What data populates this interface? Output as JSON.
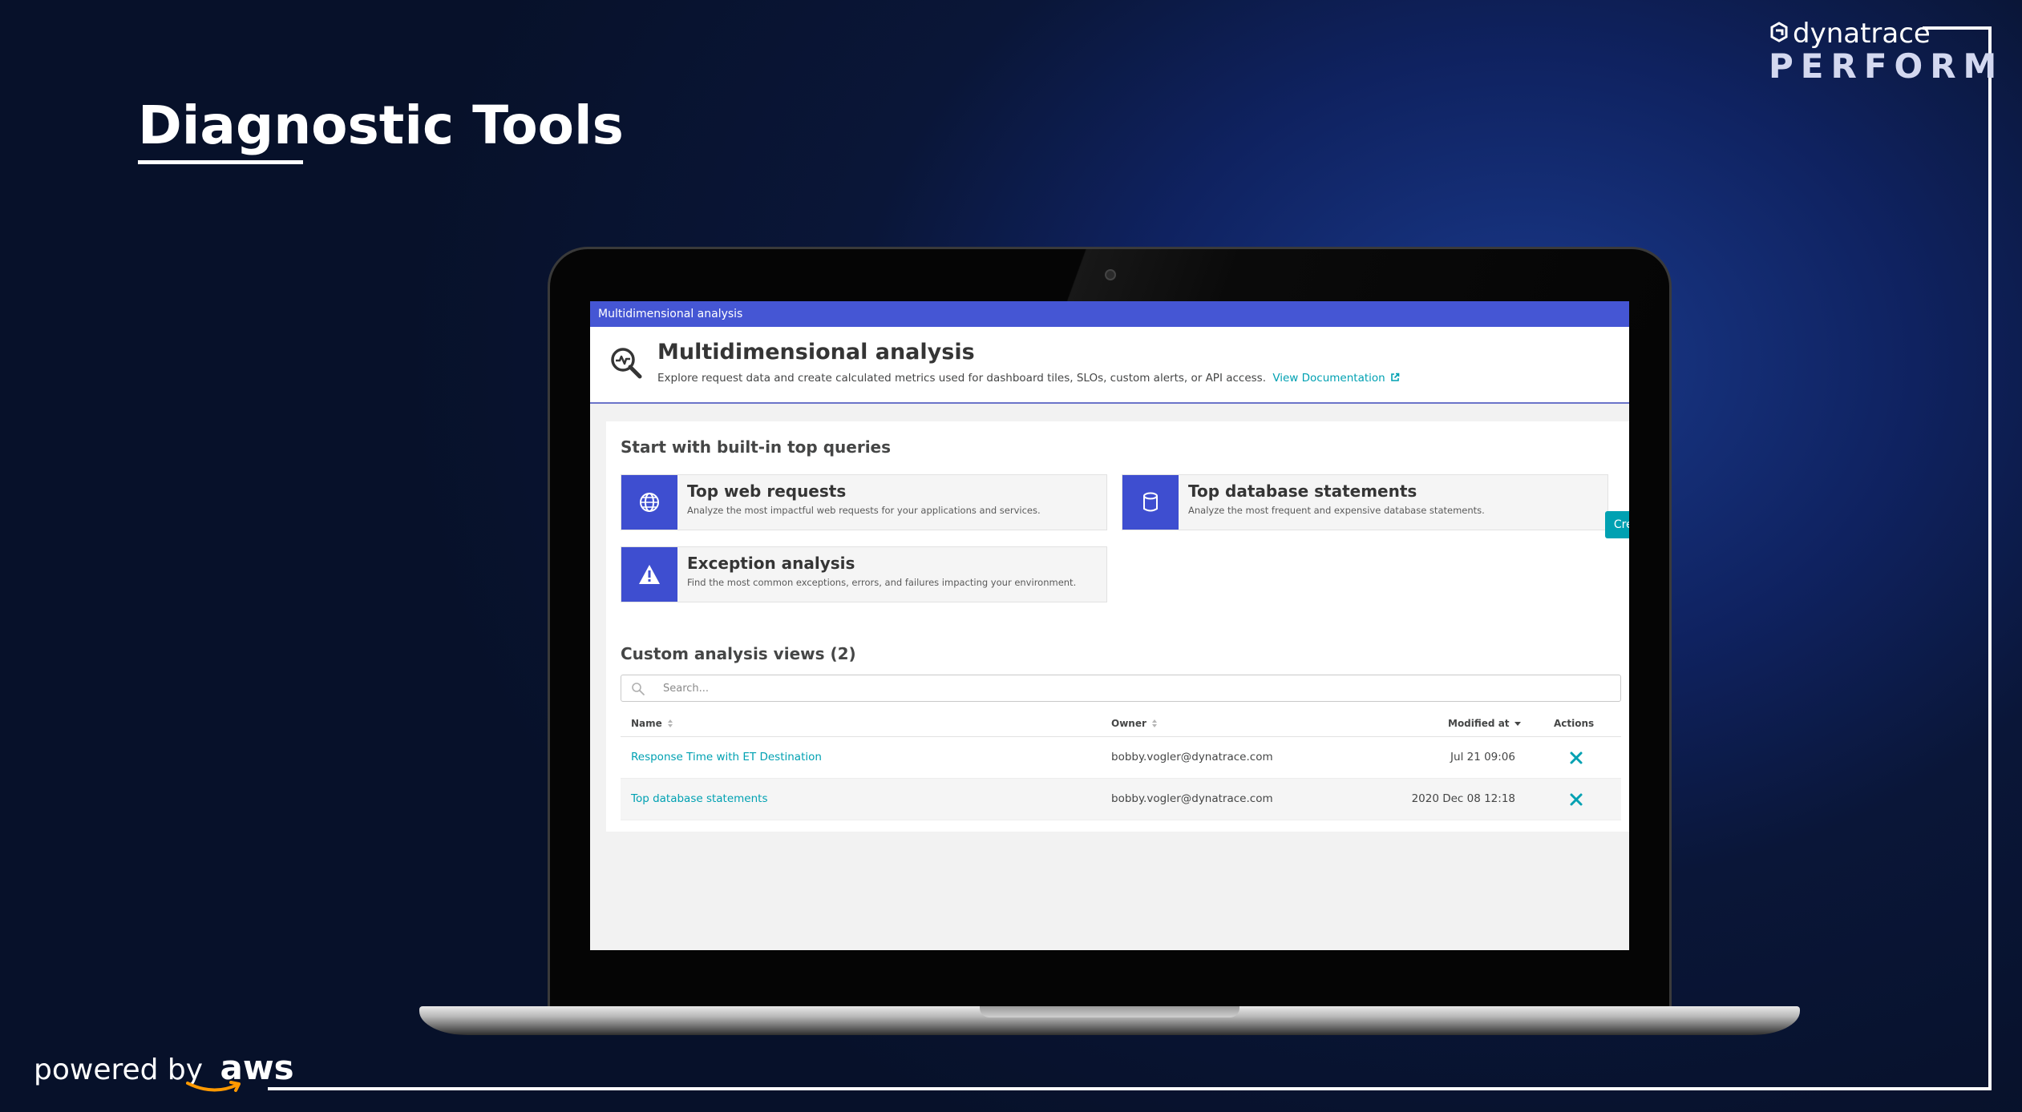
{
  "slide": {
    "title": "Diagnostic Tools",
    "brand_word": "dynatrace",
    "brand_event": "PERFORM",
    "powered_by": "powered by",
    "aws": "aws"
  },
  "app": {
    "bar_title": "Multidimensional analysis",
    "header": {
      "title": "Multidimensional analysis",
      "description": "Explore request data and create calculated metrics used for dashboard tiles, SLOs, custom alerts, or API access.",
      "doc_link": "View Documentation"
    },
    "builtin": {
      "section_title": "Start with built-in top queries",
      "tiles": [
        {
          "title": "Top web requests",
          "description": "Analyze the most impactful web requests for your applications and services.",
          "icon": "globe-icon"
        },
        {
          "title": "Top database statements",
          "description": "Analyze the most frequent and expensive database statements.",
          "icon": "database-icon"
        },
        {
          "title": "Exception analysis",
          "description": "Find the most common exceptions, errors, and failures impacting your environment.",
          "icon": "warning-icon"
        }
      ]
    },
    "custom_views": {
      "title": "Custom analysis views (2)",
      "create_button": "Create analysis view",
      "search_placeholder": "Search...",
      "columns": {
        "name": "Name",
        "owner": "Owner",
        "modified": "Modified at",
        "actions": "Actions"
      },
      "rows": [
        {
          "name": "Response Time with ET Destination",
          "owner": "bobby.vogler@dynatrace.com",
          "modified": "Jul 21 09:06"
        },
        {
          "name": "Top database statements",
          "owner": "bobby.vogler@dynatrace.com",
          "modified": "2020 Dec 08 12:18"
        }
      ]
    },
    "colors": {
      "accent": "#4556d4",
      "tile_icon_bg": "#3e4ed0",
      "link": "#00a1b2",
      "button": "#00a1b2"
    }
  }
}
